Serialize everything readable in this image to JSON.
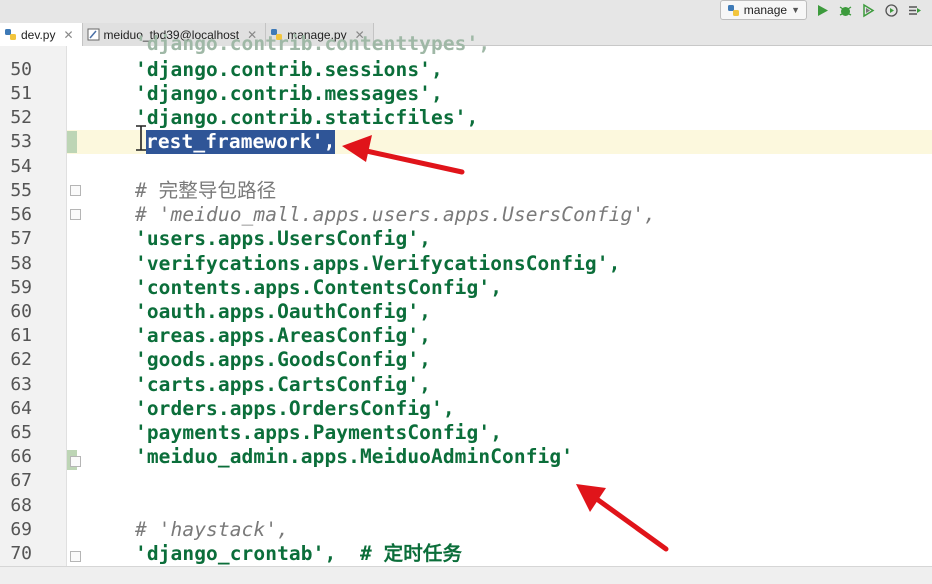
{
  "tabs": [
    {
      "label": "dev.py",
      "icon": "python-file-icon",
      "active": true
    },
    {
      "label": "meiduo_tbd39@localhost",
      "icon": "database-console-icon",
      "active": false
    },
    {
      "label": "manage.py",
      "icon": "python-file-icon",
      "active": false
    }
  ],
  "toolbar": {
    "run_config": "manage"
  },
  "editor": {
    "lines": [
      {
        "no": "50",
        "text": "'django.contrib.sessions',"
      },
      {
        "no": "51",
        "text": "'django.contrib.messages',"
      },
      {
        "no": "52",
        "text": "'django.contrib.staticfiles',"
      },
      {
        "no": "53",
        "text": "'rest_framework',"
      },
      {
        "no": "54",
        "text": ""
      },
      {
        "no": "55",
        "text": "# 完整导包路径"
      },
      {
        "no": "56",
        "text": "# 'meiduo_mall.apps.users.apps.UsersConfig',"
      },
      {
        "no": "57",
        "text": "'users.apps.UsersConfig',"
      },
      {
        "no": "58",
        "text": "'verifycations.apps.VerifycationsConfig',"
      },
      {
        "no": "59",
        "text": "'contents.apps.ContentsConfig',"
      },
      {
        "no": "60",
        "text": "'oauth.apps.OauthConfig',"
      },
      {
        "no": "61",
        "text": "'areas.apps.AreasConfig',"
      },
      {
        "no": "62",
        "text": "'goods.apps.GoodsConfig',"
      },
      {
        "no": "63",
        "text": "'carts.apps.CartsConfig',"
      },
      {
        "no": "64",
        "text": "'orders.apps.OrdersConfig',"
      },
      {
        "no": "65",
        "text": "'payments.apps.PaymentsConfig',"
      },
      {
        "no": "66",
        "text": "'meiduo_admin.apps.MeiduoAdminConfig'"
      },
      {
        "no": "67",
        "text": ""
      },
      {
        "no": "68",
        "text": ""
      },
      {
        "no": "69",
        "text": "# 'haystack',"
      },
      {
        "no": "70",
        "text": "'django_crontab',  # 定时任务"
      }
    ]
  },
  "colors": {
    "string": "#0b6e3a",
    "selection": "#2f5597",
    "arrow": "#e0141a"
  }
}
